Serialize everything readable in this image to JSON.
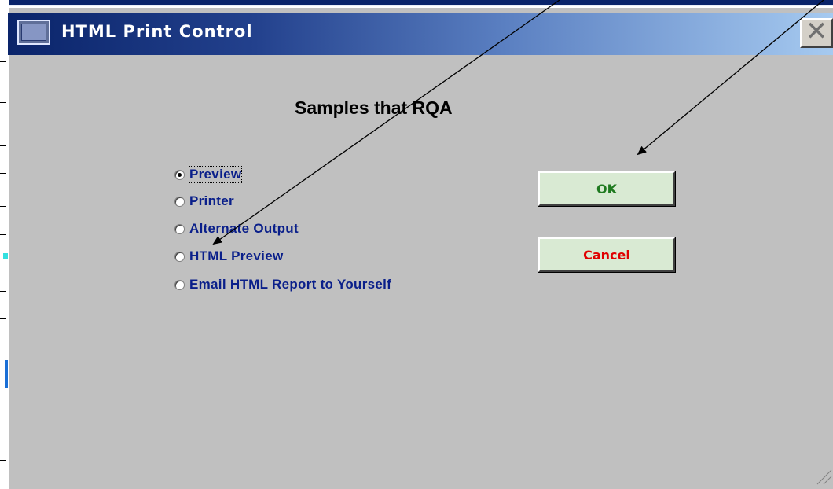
{
  "window": {
    "title": "HTML Print Control",
    "close_glyph": "✕"
  },
  "heading": "Samples that RQA",
  "output_options": [
    {
      "label": "Preview",
      "checked": true
    },
    {
      "label": "Printer",
      "checked": false
    },
    {
      "label": "Alternate Output",
      "checked": false
    },
    {
      "label": "HTML Preview",
      "checked": false
    },
    {
      "label": "Email HTML Report to Yourself",
      "checked": false
    }
  ],
  "buttons": {
    "ok_label": "OK",
    "cancel_label": "Cancel"
  },
  "colors": {
    "title_bar_start": "#0a246a",
    "ok_text": "#1f7a1f",
    "cancel_text": "#e00000",
    "option_text": "#0a1f8a",
    "dialog_bg": "#c0c0c0"
  },
  "icons": {
    "title": "window-icon",
    "close": "close-icon"
  }
}
